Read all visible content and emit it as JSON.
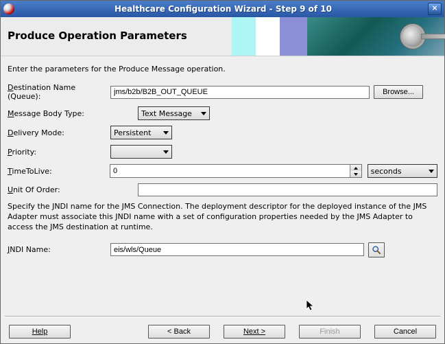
{
  "titlebar": {
    "title": "Healthcare Configuration Wizard - Step 9 of 10"
  },
  "banner": {
    "heading": "Produce Operation Parameters"
  },
  "intro": "Enter the parameters for the Produce Message operation.",
  "form": {
    "destination": {
      "label_pre": "D",
      "label_rest": "estination Name (Queue):",
      "value": "jms/b2b/B2B_OUT_QUEUE",
      "browse": "Browse..."
    },
    "msgbody": {
      "label_pre": "M",
      "label_rest": "essage Body Type:",
      "value": "Text Message"
    },
    "delivery": {
      "label_pre": "D",
      "label_rest": "elivery Mode:",
      "value": "Persistent"
    },
    "priority": {
      "label_pre": "P",
      "label_rest": "riority:",
      "value": ""
    },
    "ttl": {
      "label_pre": "T",
      "label_rest": "imeToLive:",
      "value": "0",
      "unit": "seconds"
    },
    "unitoforder": {
      "label_pre": "U",
      "label_rest": "nit Of Order:",
      "value": ""
    },
    "jndi_desc": "Specify the JNDI name for the JMS Connection.  The deployment descriptor for the deployed instance of the JMS Adapter must associate this JNDI name with a set of configuration properties needed by the JMS Adapter to access the JMS destination at runtime.",
    "jndi": {
      "label_pre": "J",
      "label_rest": "NDI Name:",
      "value": "eis/wls/Queue"
    }
  },
  "buttons": {
    "help": "Help",
    "back": "< Back",
    "next": "Next >",
    "finish": "Finish",
    "cancel": "Cancel"
  }
}
